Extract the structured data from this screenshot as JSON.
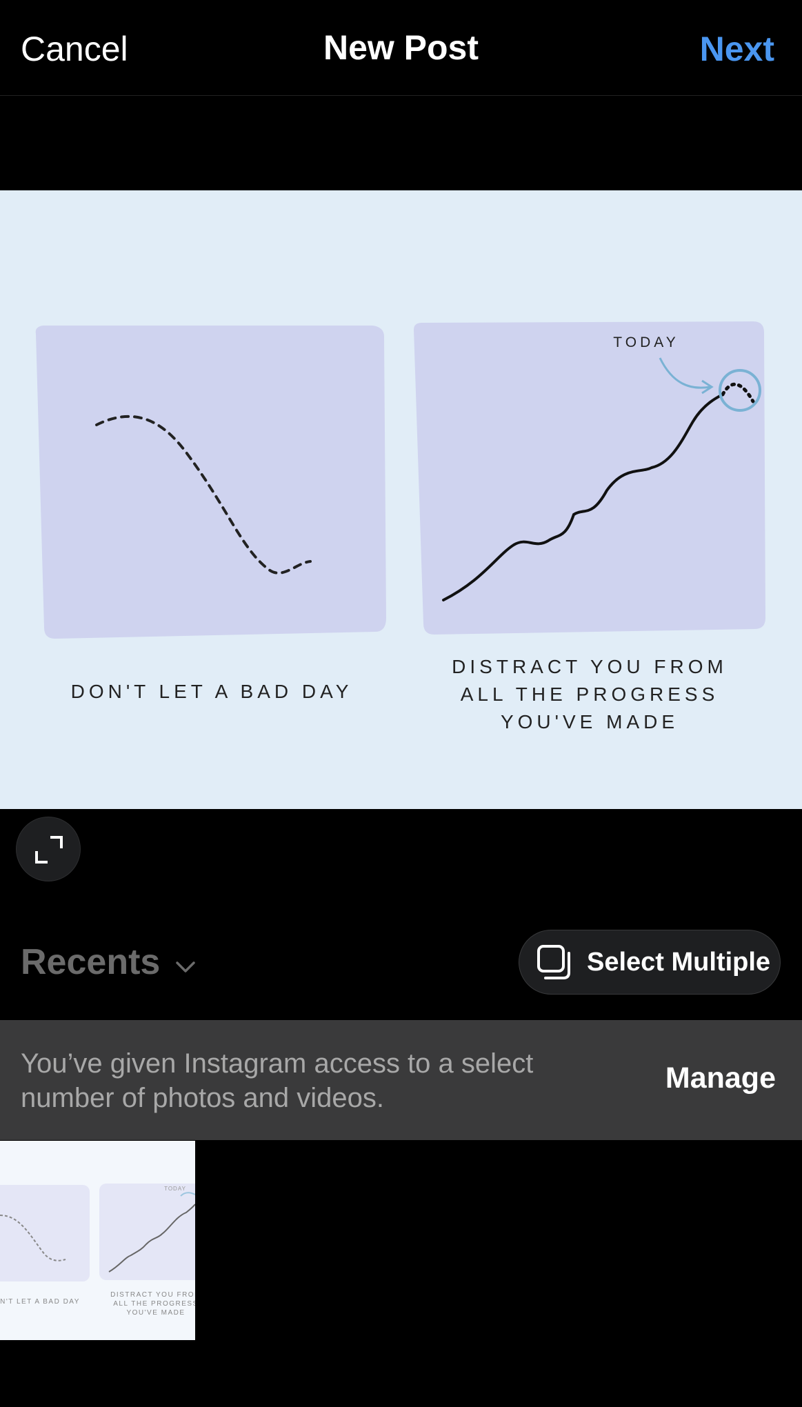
{
  "header": {
    "cancel_label": "Cancel",
    "title": "New Post",
    "next_label": "Next",
    "accent_color": "#4a96f0"
  },
  "preview": {
    "today_label": "TODAY",
    "left_caption": "DON'T LET A BAD DAY",
    "right_caption_lines": [
      "DISTRACT YOU FROM",
      "ALL THE PROGRESS",
      "YOU'VE MADE"
    ],
    "expand_icon": "expand-icon"
  },
  "gallery": {
    "album_label": "Recents",
    "album_icon": "chevron-down-icon",
    "select_multiple_label": "Select Multiple",
    "select_multiple_icon": "multi-select-icon"
  },
  "access_banner": {
    "message": "You’ve given Instagram access to a select number of photos and videos.",
    "manage_label": "Manage"
  },
  "thumbnails": [
    {
      "today_label": "TODAY",
      "left_caption": "N'T LET A BAD DAY",
      "right_caption_lines": [
        "DISTRACT YOU FROM",
        "ALL THE PROGRESS",
        "YOU'VE MADE"
      ]
    }
  ]
}
